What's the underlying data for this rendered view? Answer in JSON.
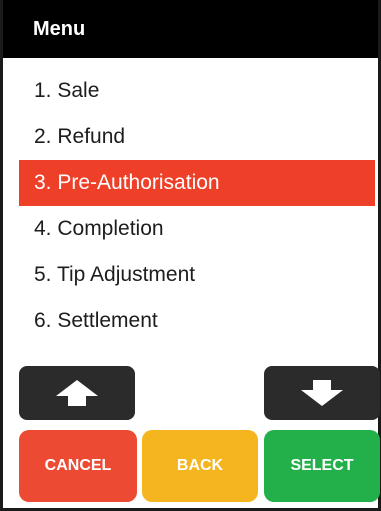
{
  "title": "Menu",
  "menu": {
    "items": [
      {
        "label": "1. Sale"
      },
      {
        "label": "2. Refund"
      },
      {
        "label": "3. Pre-Authorisation",
        "selected": true
      },
      {
        "label": "4. Completion"
      },
      {
        "label": "5. Tip Adjustment"
      },
      {
        "label": "6. Settlement"
      }
    ]
  },
  "nav": {
    "up_icon": "arrow-up-icon",
    "down_icon": "arrow-down-icon"
  },
  "buttons": {
    "cancel": "CANCEL",
    "back": "BACK",
    "select": "SELECT"
  },
  "colors": {
    "highlight": "#ee4028",
    "cancel": "#ec4a32",
    "back": "#f5b51e",
    "select": "#23b04b",
    "arrow_button": "#2b2b2b"
  }
}
